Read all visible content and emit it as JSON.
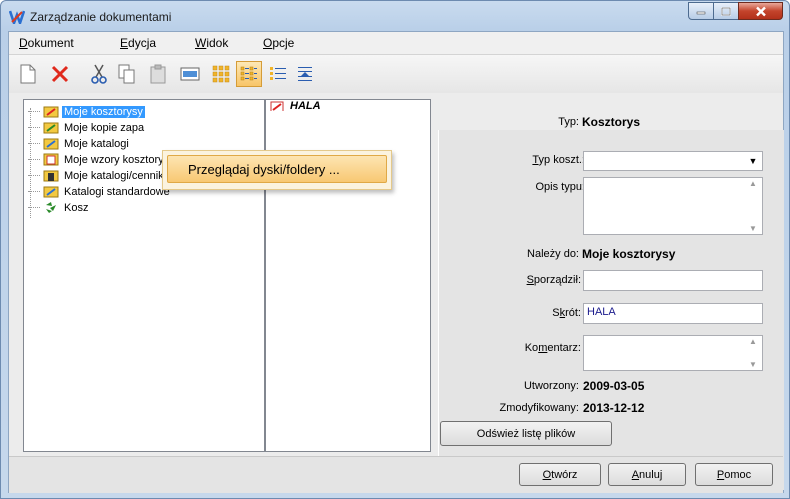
{
  "window": {
    "title": "Zarządzanie dokumentami"
  },
  "menu": [
    {
      "hot": "D",
      "rest": "okument"
    },
    {
      "hot": "E",
      "rest": "dycja"
    },
    {
      "hot": "W",
      "rest": "idok"
    },
    {
      "hot": "O",
      "rest": "pcje"
    }
  ],
  "toolbar": {
    "icons": [
      "new-document-icon",
      "delete-icon",
      "cut-icon",
      "copy-icon",
      "paste-icon",
      "preview-icon",
      "large-icons-view-icon",
      "small-icons-view-icon",
      "list-view-icon",
      "details-view-icon"
    ]
  },
  "tree": [
    {
      "label": "Moje kosztorysy",
      "selected": true
    },
    {
      "label": "Moje kopie zapa"
    },
    {
      "label": "Moje katalogi"
    },
    {
      "label": "Moje wzory kosztorysów"
    },
    {
      "label": "Moje katalogi/cenniki obiektów"
    },
    {
      "label": "Katalogi standardowe"
    },
    {
      "label": "Kosz"
    }
  ],
  "files": [
    {
      "label": "HALA"
    }
  ],
  "context_menu": {
    "item": "Przeglądaj dyski/foldery ..."
  },
  "props": {
    "typ_label": "Typ:",
    "typ_value": "Kosztorys",
    "typ_kosz_label_hot": "T",
    "typ_kosz_label_rest": "yp koszt.:",
    "typ_kosz_value": "",
    "opis_label": "Opis typu:",
    "nalezy_label": "Należy do:",
    "nalezy_value": "Moje kosztorysy",
    "sporzadzil_hot": "S",
    "sporzadzil_rest": "porządził:",
    "sporzadzil_value": "",
    "skrot_pre": "S",
    "skrot_hot": "k",
    "skrot_rest": "rót:",
    "skrot_value": "HALA",
    "komentarz_pre": "Ko",
    "komentarz_hot": "m",
    "komentarz_rest": "entarz:",
    "komentarz_value": "",
    "utworzony_label": "Utworzony:",
    "utworzony_value": "2009-03-05",
    "zmodyfikowany_label": "Zmodyfikowany:",
    "zmodyfikowany_value": "2013-12-12",
    "refresh_button": "Odśwież listę plików"
  },
  "footer": {
    "open_hot": "O",
    "open_rest": "twórz",
    "cancel_hot": "A",
    "cancel_rest": "nuluj",
    "help_hot": "P",
    "help_rest": "omoc"
  }
}
